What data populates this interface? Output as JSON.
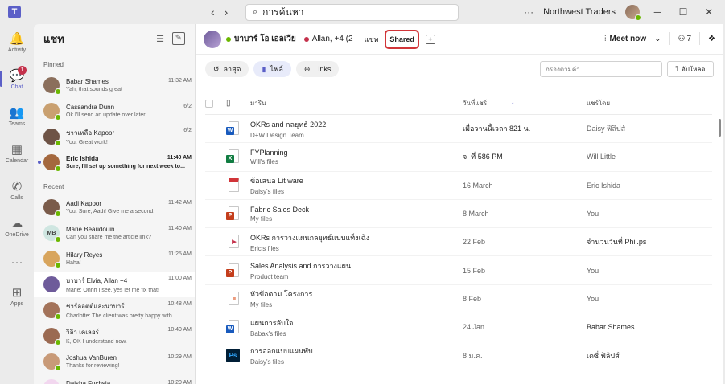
{
  "titlebar": {
    "search_value": "การค้นหา",
    "org_name": "Northwest Traders",
    "more": "···"
  },
  "rail": [
    {
      "label": "Activity",
      "icon": "bell-icon",
      "glyph": "🔔"
    },
    {
      "label": "Chat",
      "icon": "chat-icon",
      "glyph": "💬",
      "badge": "1",
      "active": true
    },
    {
      "label": "Teams",
      "icon": "teams-icon",
      "glyph": "👥"
    },
    {
      "label": "Calendar",
      "icon": "calendar-icon",
      "glyph": "▦"
    },
    {
      "label": "Calls",
      "icon": "phone-icon",
      "glyph": "✆"
    },
    {
      "label": "OneDrive",
      "icon": "cloud-icon",
      "glyph": "☁"
    },
    {
      "label": "",
      "icon": "more-icon",
      "glyph": "···"
    },
    {
      "label": "Apps",
      "icon": "apps-icon",
      "glyph": "⊞"
    }
  ],
  "chatlist": {
    "title": "แชท",
    "pinned_label": "Pinned",
    "recent_label": "Recent",
    "pinned": [
      {
        "name": "Babar Shames",
        "time": "11:32 AM",
        "preview": "Yah, that sounds great",
        "color": "#8b6f5c",
        "presence": "online"
      },
      {
        "name": "Cassandra Dunn",
        "time": "6/2",
        "preview": "Ok I'll send an update over later",
        "color": "#c9a070",
        "presence": "online"
      },
      {
        "name": "ชาวเหลือ Kapoor",
        "time": "6/2",
        "preview": "You: Great work!",
        "color": "#6e5346",
        "presence": "online"
      },
      {
        "name": "Eric Ishida",
        "time": "11:40 AM",
        "preview": "Sure, I'll set up something for next week to...",
        "color": "#a4683e",
        "presence": "online",
        "unread": true
      }
    ],
    "recent": [
      {
        "name": "Aadi Kapoor",
        "time": "11:42 AM",
        "preview": "You: Sure, Aadi! Give me a second.",
        "color": "#7a5b4a",
        "presence": "online"
      },
      {
        "name": "Marie Beaudouin",
        "time": "11:40 AM",
        "preview": "Can you share me the article link?",
        "color": "#cfe6e1",
        "initials": "MB",
        "presence": "online"
      },
      {
        "name": "Hilary Reyes",
        "time": "11:25 AM",
        "preview": "Haha!",
        "color": "#d8a55d",
        "presence": "online"
      },
      {
        "name": "บาบาร์ Elvia, Allan +4",
        "time": "11:00 AM",
        "preview": "Marie: Ohhh I see, yes let me fix that!",
        "color": "#6e5b9a",
        "presence": "none",
        "selected": true
      },
      {
        "name": "ชาร์ลอตต์และนาบาร์",
        "time": "10:48 AM",
        "preview": "Charlotte: The client was pretty happy with...",
        "color": "#a3735a",
        "presence": "online"
      },
      {
        "name": "วิลิา เคเลอร์",
        "time": "10:40 AM",
        "preview": "K, OK I understand now.",
        "color": "#9b6a52",
        "presence": "online"
      },
      {
        "name": "Joshua VanBuren",
        "time": "10:29 AM",
        "preview": "Thanks for reviewing!",
        "color": "#c89a78",
        "presence": "online"
      },
      {
        "name": "Daisha Fuchsia",
        "time": "10:20 AM",
        "preview": "You: Thank you!!",
        "color": "#f2d7ef",
        "initials": "DF",
        "presence": "away"
      }
    ]
  },
  "header": {
    "chat_name": "บาบาร์ โอ เอลเวีย",
    "participants": "Allan, +4 (2",
    "tab_chat": "แชท",
    "tab_shared": "Shared",
    "meet_now": "Meet now",
    "people_count": "7"
  },
  "filters": {
    "recent": "ลาสุด",
    "files": "ไฟล์",
    "links": "Links",
    "filter_placeholder": "กรองตามคำ",
    "upload": "อัปโหลด"
  },
  "table": {
    "headers": {
      "name": "มาริน",
      "date": "วันที่แชร์",
      "by": "แชร์โดย"
    },
    "rows": [
      {
        "name": "OKRs and กลยุทธ์ 2022",
        "location": "D+W Design Team",
        "date": "เมื่อวานนี้เวลา 821 น.",
        "by": "Daisy ฟิลิปส์",
        "icon": "word-file-icon",
        "type": "word",
        "date_dark": true,
        "by_dark": false
      },
      {
        "name": "FYPlanning",
        "location": "Will's files",
        "date": "จ. ที่ 586 PM",
        "by": "Will Little",
        "icon": "excel-file-icon",
        "type": "excel",
        "date_dark": true,
        "by_dark": false
      },
      {
        "name": "ข้อเสนอ Lit ware",
        "location": "Daisy's files",
        "date": "16 March",
        "by": "Eric Ishida",
        "icon": "pdf-file-icon",
        "type": "pdf",
        "date_dark": false,
        "by_dark": false
      },
      {
        "name": "Fabric Sales Deck",
        "location": "My files",
        "date": "8 March",
        "by": "You",
        "icon": "powerpoint-file-icon",
        "type": "ppt",
        "date_dark": false,
        "by_dark": false
      },
      {
        "name": "OKRs การวางแผนกลยุทธ์แบบแท็งเฉิง",
        "location": "Eric's files",
        "date": "22 Feb",
        "by": "จำนวนวันที่ Phil.ps",
        "icon": "video-file-icon",
        "type": "video",
        "date_dark": false,
        "by_dark": true
      },
      {
        "name": "Sales Analysis and การวางแผน",
        "location": "Product team",
        "date": "15 Feb",
        "by": "You",
        "icon": "powerpoint-file-icon",
        "type": "ppt",
        "date_dark": false,
        "by_dark": false
      },
      {
        "name": "หัวข้อตาม.โครงการ",
        "location": "My files",
        "date": "8 Feb",
        "by": "You",
        "icon": "list-file-icon",
        "type": "list",
        "date_dark": false,
        "by_dark": false
      },
      {
        "name": "แผนการลับใจ",
        "location": "Babak's files",
        "date": "24 Jan",
        "by": "Babar Shames",
        "icon": "word-file-icon",
        "type": "word",
        "date_dark": false,
        "by_dark": true
      },
      {
        "name": "การออกแบบแผนพับ",
        "location": "Daisy's files",
        "date": "8 ม.ค.",
        "by": "เดซี่ ฟิลิปส์",
        "icon": "photoshop-file-icon",
        "type": "ps",
        "date_dark": false,
        "by_dark": true
      }
    ]
  },
  "colors": {
    "accent": "#5b5fc7",
    "highlight_border": "#d13438",
    "presence_online": "#6bb700",
    "presence_away": "#f8d22a"
  }
}
